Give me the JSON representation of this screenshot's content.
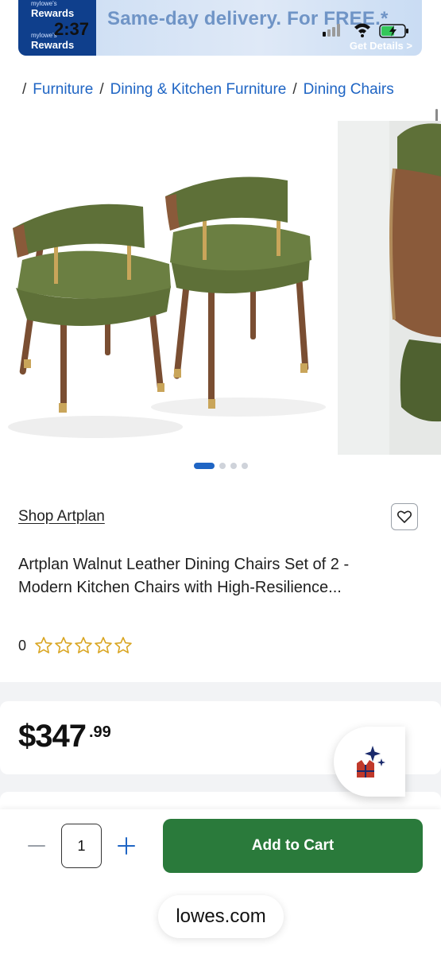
{
  "status_bar": {
    "time": "2:37"
  },
  "banner": {
    "logo_line1": "mylowe's",
    "logo_line2": "Rewards",
    "logo_line3": "mylowe's",
    "logo_line4": "Rewards",
    "headline": "Same-day delivery. For FREE.*",
    "cta": "Get Details >"
  },
  "breadcrumb": {
    "separator": "/",
    "items": [
      "Furniture",
      "Dining & Kitchen Furniture",
      "Dining Chairs"
    ]
  },
  "gallery": {
    "image_count": 4,
    "active_index": 0
  },
  "product": {
    "shop_link": "Shop Artplan",
    "title_line1": "Artplan Walnut Leather Dining Chairs Set of 2 -",
    "title_line2": "Modern Kitchen Chairs with High-Resilience...",
    "rating_count": "0",
    "rating_value": 0,
    "max_stars": 5
  },
  "price": {
    "dollars": "$347",
    "cents": ".99"
  },
  "cart": {
    "quantity": "1",
    "add_label": "Add to Cart"
  },
  "browser": {
    "url": "lowes.com"
  },
  "colors": {
    "link_blue": "#1f65c4",
    "cart_green": "#2a7a3b",
    "star_gold": "#d9a521",
    "banner_navy": "#0f3f8c",
    "chair_green": "#5e7038",
    "walnut": "#8a5a3a"
  },
  "icons": {
    "heart": "heart-icon",
    "minus": "minus-icon",
    "plus": "plus-icon",
    "star": "star-outline-icon",
    "ai": "sparkle-vest-icon"
  }
}
